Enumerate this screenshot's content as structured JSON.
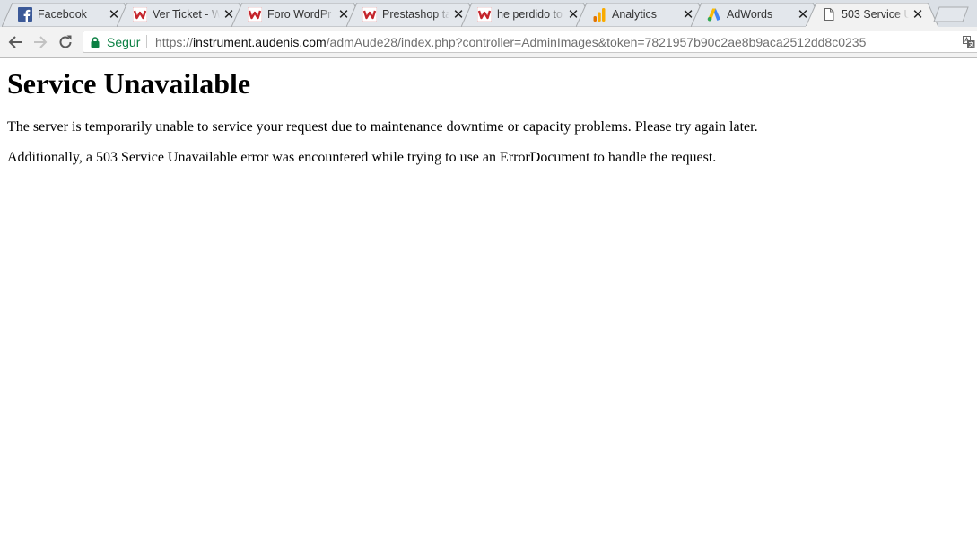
{
  "browser": {
    "tabs": [
      {
        "title": "Facebook",
        "icon": "facebook-icon"
      },
      {
        "title": "Ver Ticket - W",
        "icon": "w-logo-icon"
      },
      {
        "title": "Foro WordPr",
        "icon": "w-logo-icon"
      },
      {
        "title": "Prestashop ta",
        "icon": "w-logo-icon"
      },
      {
        "title": "he perdido to",
        "icon": "w-logo-icon"
      },
      {
        "title": "Analytics",
        "icon": "analytics-icon"
      },
      {
        "title": "AdWords",
        "icon": "adwords-icon"
      },
      {
        "title": "503 Service U",
        "icon": "page-icon",
        "active": true
      }
    ],
    "address_bar": {
      "security_label": "Segur",
      "url_scheme": "https://",
      "url_host": "instrument.audenis.com",
      "url_path": "/admAude28/index.php?controller=AdminImages&token=7821957b90c2ae8b9aca2512dd8c0235"
    },
    "colors": {
      "tabstrip": "#dbe0e6",
      "inactive_tab": "#e3e7ec",
      "active_tab": "#f2f2f2",
      "secure_green": "#0b8043",
      "facebook_blue": "#3b5998",
      "w_red": "#c4242b"
    }
  },
  "page": {
    "heading": "Service Unavailable",
    "paragraph1": "The server is temporarily unable to service your request due to maintenance downtime or capacity problems. Please try again later.",
    "paragraph2": "Additionally, a 503 Service Unavailable error was encountered while trying to use an ErrorDocument to handle the request."
  }
}
